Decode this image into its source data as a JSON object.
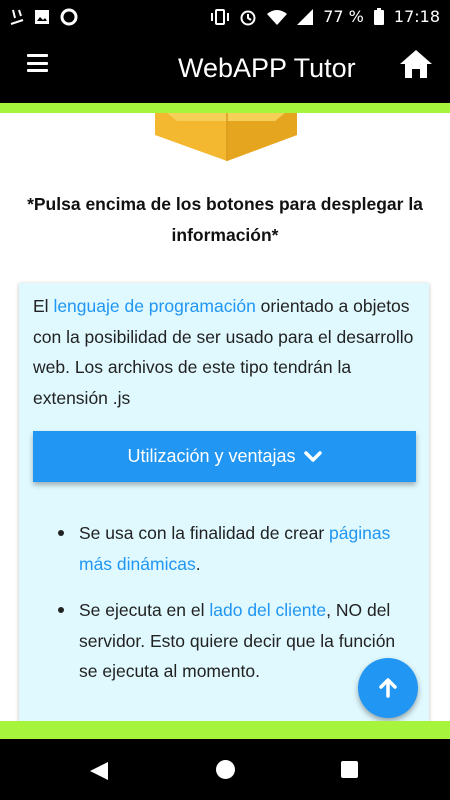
{
  "status_bar": {
    "battery": "77 %",
    "time": "17:18",
    "icons": [
      "notification-icon",
      "image-icon",
      "circle-icon",
      "vibrate-icon",
      "alarm-icon",
      "wifi-icon",
      "signal-icon",
      "battery-icon"
    ]
  },
  "app_bar": {
    "title": "WebAPP Tutor",
    "menu_icon": "hamburger-menu-icon",
    "home_icon": "home-icon"
  },
  "instruction": "*Pulsa encima de los botones para desplegar la información*",
  "card": {
    "intro_before": "El ",
    "intro_link": "lenguaje de programación",
    "intro_after": " orientado a objetos con la posibilidad de ser usado para el desarrollo web. Los archivos de este tipo tendrán la extensión .js",
    "accordion_label": "Utilización y ventajas",
    "bullets": [
      {
        "before": "Se usa con la finalidad de crear ",
        "link": "páginas más dinámicas",
        "after": "."
      },
      {
        "before": "Se ejecuta en el ",
        "link": "lado del cliente",
        "after": ", NO del servidor. Esto quiere decir que la función se ejecuta al momento."
      }
    ]
  },
  "fab": {
    "icon": "arrow-up-icon"
  },
  "colors": {
    "accent_green": "#a7f43c",
    "primary_blue": "#2196f3",
    "card_bg": "#dff9ff",
    "box_yellow": "#f3b830"
  }
}
